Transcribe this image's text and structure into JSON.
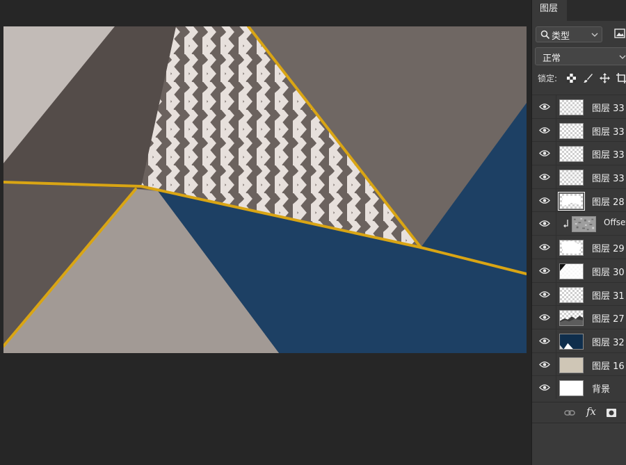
{
  "layers_panel": {
    "tab_label": "图层",
    "filter": {
      "kind_label": "类型",
      "icon": "search-icon"
    },
    "blend_mode": "正常",
    "lock_label": "锁定:",
    "lock_icons": [
      "lock-transparent-pixels-icon",
      "lock-image-pixels-icon",
      "lock-position-icon",
      "lock-artboard-icon"
    ],
    "layers": [
      {
        "name": "图层 33",
        "visible": true,
        "thumb": "transparent"
      },
      {
        "name": "图层 33",
        "visible": true,
        "thumb": "transparent"
      },
      {
        "name": "图层 33",
        "visible": true,
        "thumb": "transparent"
      },
      {
        "name": "图层 33",
        "visible": true,
        "thumb": "transparent"
      },
      {
        "name": "图层 28",
        "visible": true,
        "thumb": "transparent-shape",
        "selected": true
      },
      {
        "name": "Offset",
        "visible": true,
        "thumb": "noise",
        "clipped": true
      },
      {
        "name": "图层 29",
        "visible": true,
        "thumb": "transparent-blob"
      },
      {
        "name": "图层 30",
        "visible": true,
        "thumb": "transparent-dark-corner"
      },
      {
        "name": "图层 31",
        "visible": true,
        "thumb": "transparent"
      },
      {
        "name": "图层 27",
        "visible": true,
        "thumb": "transparent-skyline"
      },
      {
        "name": "图层 32",
        "visible": true,
        "thumb": "navy"
      },
      {
        "name": "图层 16",
        "visible": true,
        "thumb": "beige"
      },
      {
        "name": "背景",
        "visible": true,
        "thumb": "white"
      }
    ],
    "bottom_icons": [
      "link-layers-icon",
      "fx-icon",
      "add-mask-icon"
    ],
    "fx_label": "fx"
  },
  "colors": {
    "app_bg": "#262626",
    "panel_bg": "#393939",
    "gold": "#d9a514",
    "navy": "#1c3f62",
    "concrete_dark": "#5b5350",
    "concrete_mid": "#756d68",
    "concrete_light": "#b8b0ab"
  }
}
